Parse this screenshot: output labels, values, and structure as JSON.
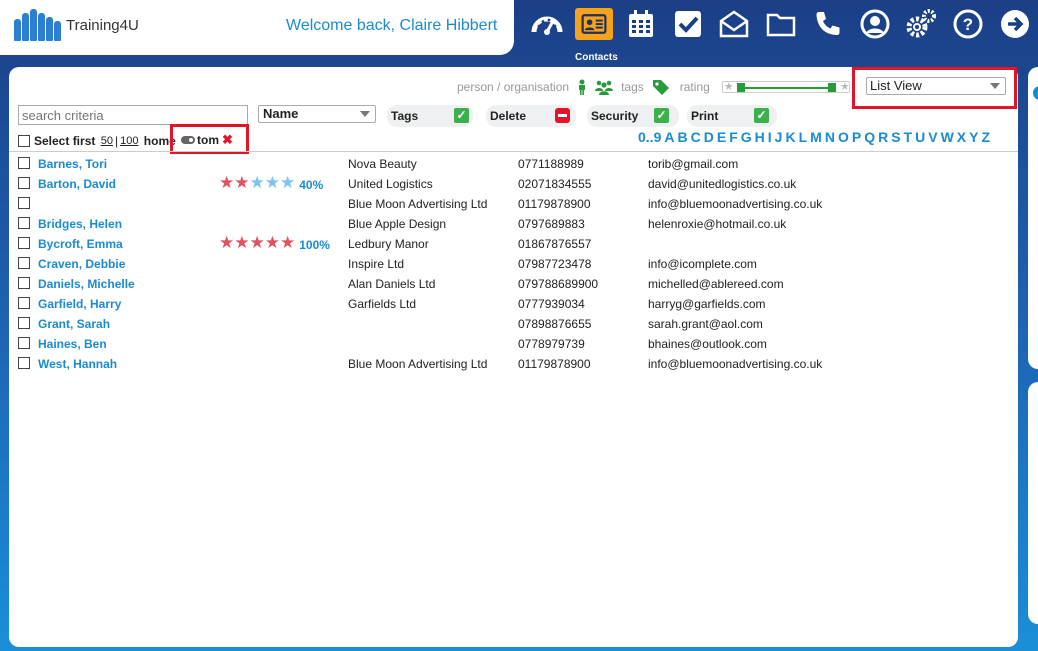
{
  "app": {
    "name": "Training4U",
    "welcome": "Welcome back, Claire Hibbert"
  },
  "nav": {
    "items": [
      {
        "icon": "dashboard-gauge-icon",
        "label": ""
      },
      {
        "icon": "contacts-card-icon",
        "label": "Contacts",
        "active": true
      },
      {
        "icon": "calendar-icon",
        "label": ""
      },
      {
        "icon": "tasks-check-icon",
        "label": ""
      },
      {
        "icon": "mail-open-icon",
        "label": ""
      },
      {
        "icon": "folder-icon",
        "label": ""
      },
      {
        "icon": "phone-icon",
        "label": ""
      },
      {
        "icon": "user-account-icon",
        "label": ""
      },
      {
        "icon": "settings-gears-icon",
        "label": ""
      },
      {
        "icon": "help-question-icon",
        "label": ""
      },
      {
        "icon": "logout-arrow-icon",
        "label": ""
      }
    ],
    "active_label": "Contacts"
  },
  "filters": {
    "person_org_label": "person / organisation",
    "tags_label": "tags",
    "rating_label": "rating",
    "view_select": "List View"
  },
  "search": {
    "placeholder": "search criteria",
    "value": ""
  },
  "sort_select": "Name",
  "toggles": {
    "tags": "Tags",
    "delete": "Delete",
    "security": "Security",
    "print": "Print"
  },
  "select_first": {
    "label": "Select first",
    "opt1": "50",
    "sep": "|",
    "opt2": "100",
    "home": "home"
  },
  "active_tag": "tom",
  "alphabet": [
    "0..9",
    "A",
    "B",
    "C",
    "D",
    "E",
    "F",
    "G",
    "H",
    "I",
    "J",
    "K",
    "L",
    "M",
    "N",
    "O",
    "P",
    "Q",
    "R",
    "S",
    "T",
    "U",
    "V",
    "W",
    "X",
    "Y",
    "Z"
  ],
  "contacts": [
    {
      "name": "Barnes, Tori",
      "rating": null,
      "rating_pct": "",
      "org": "Nova Beauty",
      "phone": "0771188989",
      "email": "torib@gmail.com"
    },
    {
      "name": "Barton, David",
      "rating": 2,
      "rating_pct": "40%",
      "org": "United Logistics",
      "phone": "02071834555",
      "email": "david@unitedlogistics.co.uk"
    },
    {
      "name": "",
      "rating": null,
      "rating_pct": "",
      "org": "Blue Moon Advertising Ltd",
      "phone": "01179878900",
      "email": "info@bluemoonadvertising.co.uk"
    },
    {
      "name": "Bridges, Helen",
      "rating": null,
      "rating_pct": "",
      "org": "Blue Apple Design",
      "phone": "0797689883",
      "email": "helenroxie@hotmail.co.uk"
    },
    {
      "name": "Bycroft, Emma",
      "rating": 5,
      "rating_pct": "100%",
      "org": "Ledbury Manor",
      "phone": "01867876557",
      "email": ""
    },
    {
      "name": "Craven, Debbie",
      "rating": null,
      "rating_pct": "",
      "org": "Inspire Ltd",
      "phone": "07987723478",
      "email": "info@icomplete.com"
    },
    {
      "name": "Daniels, Michelle",
      "rating": null,
      "rating_pct": "",
      "org": "Alan Daniels Ltd",
      "phone": "079788689900",
      "email": "michelled@ablereed.com"
    },
    {
      "name": "Garfield, Harry",
      "rating": null,
      "rating_pct": "",
      "org": "Garfields Ltd",
      "phone": "0777939034",
      "email": "harryg@garfields.com"
    },
    {
      "name": "Grant, Sarah",
      "rating": null,
      "rating_pct": "",
      "org": "",
      "phone": "07898876655",
      "email": "sarah.grant@aol.com"
    },
    {
      "name": "Haines, Ben",
      "rating": null,
      "rating_pct": "",
      "org": "",
      "phone": "0778979739",
      "email": "bhaines@outlook.com"
    },
    {
      "name": "West, Hannah",
      "rating": null,
      "rating_pct": "",
      "org": "Blue Moon Advertising Ltd",
      "phone": "01179878900",
      "email": "info@bluemoonadvertising.co.uk"
    }
  ],
  "colors": {
    "accent": "#1a8bd1",
    "nav_active": "#f7a21b",
    "highlight": "#e0152a",
    "green": "#3bb04b"
  }
}
